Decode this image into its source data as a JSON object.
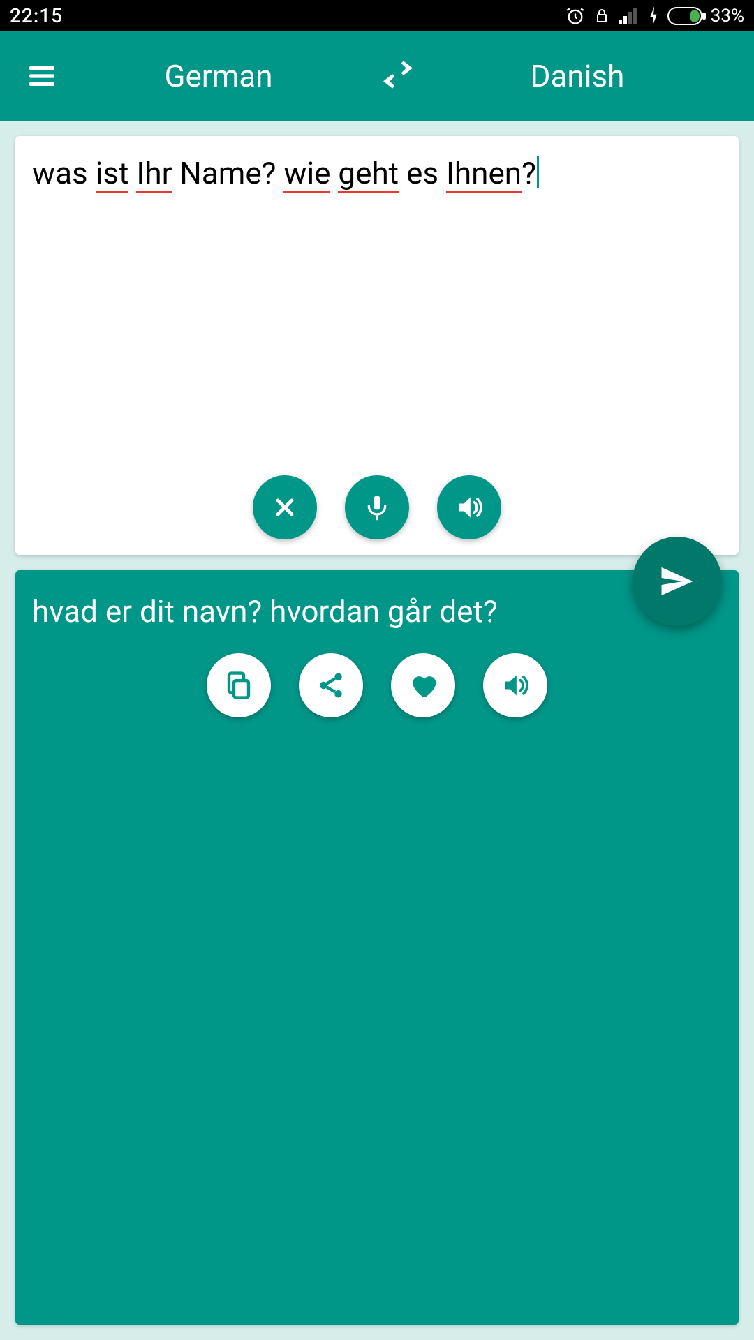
{
  "status": {
    "time": "22:15",
    "battery_pct": "33%"
  },
  "header": {
    "source_lang": "German",
    "target_lang": "Danish"
  },
  "input": {
    "words": [
      {
        "t": "was",
        "err": false
      },
      {
        "t": " ",
        "err": false
      },
      {
        "t": "ist",
        "err": true
      },
      {
        "t": " ",
        "err": false
      },
      {
        "t": "Ihr",
        "err": true
      },
      {
        "t": " ",
        "err": false
      },
      {
        "t": "Name? ",
        "err": false
      },
      {
        "t": "wie",
        "err": true
      },
      {
        "t": " ",
        "err": false
      },
      {
        "t": "geht",
        "err": true
      },
      {
        "t": " ",
        "err": false
      },
      {
        "t": "es ",
        "err": false
      },
      {
        "t": "Ihnen",
        "err": true
      },
      {
        "t": "?",
        "err": false
      }
    ],
    "plain": "was ist Ihr Name? wie geht es Ihnen?"
  },
  "output": {
    "text": "hvad er dit navn? hvordan går det?"
  },
  "colors": {
    "primary": "#009688",
    "primary_dark": "#00796b",
    "error_underline": "#e53935"
  },
  "icons": {
    "menu": "menu-icon",
    "swap": "swap-icon",
    "clear": "close-icon",
    "mic": "microphone-icon",
    "speak_src": "speaker-icon",
    "send": "send-icon",
    "copy": "copy-icon",
    "share": "share-icon",
    "favorite": "heart-icon",
    "speak_tgt": "speaker-icon"
  }
}
